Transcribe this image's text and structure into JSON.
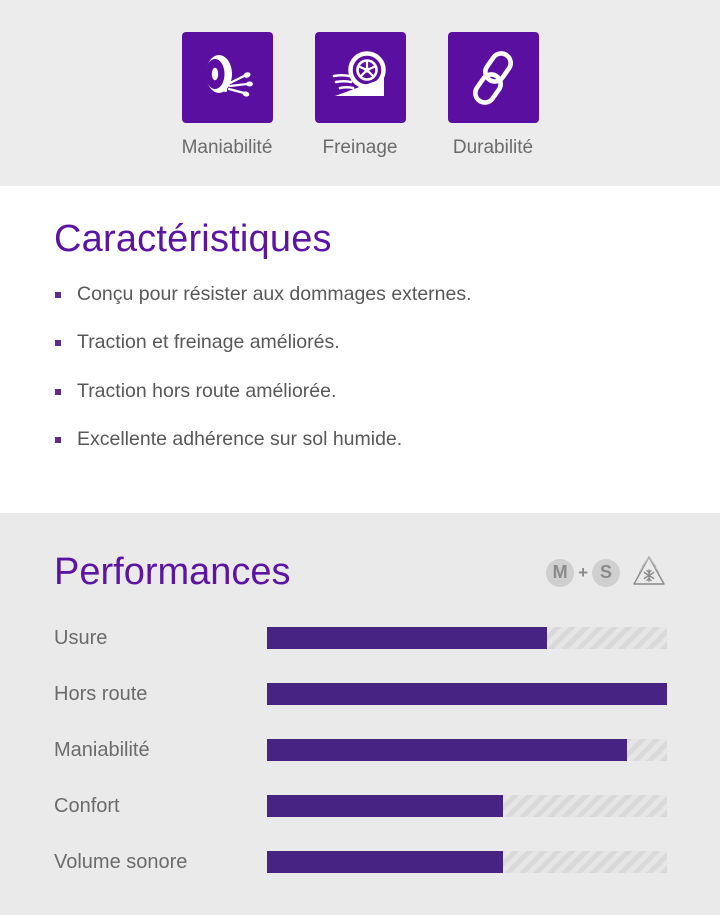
{
  "colors": {
    "brand_purple": "#5B0FA0",
    "heading_purple": "#5B15A0",
    "bar_fill": "#472484",
    "bar_track": "#d9d9d9",
    "band_bg": "#ececec",
    "section_bg": "#eaeaea",
    "text_gray": "#6b6b6b"
  },
  "top_features": [
    {
      "label": "Maniabilité",
      "icon": "tire-splash-icon"
    },
    {
      "label": "Freinage",
      "icon": "wheel-braking-slope-icon"
    },
    {
      "label": "Durabilité",
      "icon": "chain-link-icon"
    }
  ],
  "characteristics": {
    "heading": "Caractéristiques",
    "items": [
      "Conçu pour résister aux dommages externes.",
      "Traction et freinage améliorés.",
      "Traction hors route améliorée.",
      "Excellente adhérence sur sol humide."
    ]
  },
  "performances": {
    "heading": "Performances",
    "badges": {
      "m_letter": "M",
      "plus": "+",
      "s_letter": "S",
      "threepmsf": "3pmsf-snowflake-icon"
    },
    "chart_data": {
      "type": "bar",
      "title": "Performances",
      "categories": [
        "Usure",
        "Hors route",
        "Maniabilité",
        "Confort",
        "Volume sonore"
      ],
      "values": [
        70,
        100,
        90,
        59,
        59
      ],
      "xlabel": "",
      "ylabel": "",
      "xlim": [
        0,
        100
      ],
      "grid": false,
      "legend": "none",
      "orientation": "horizontal"
    }
  }
}
